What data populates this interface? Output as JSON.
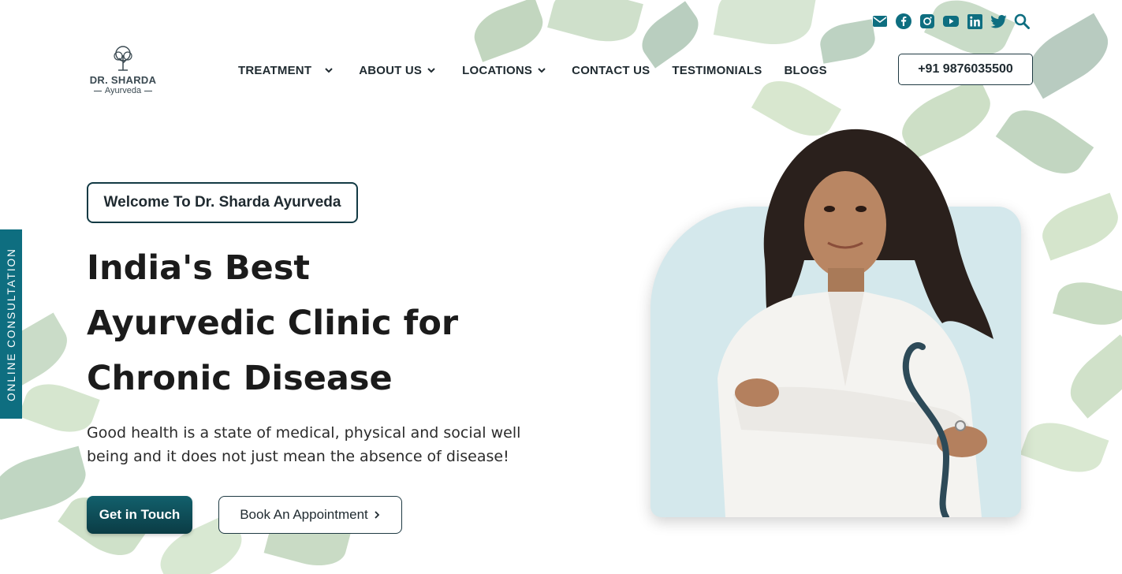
{
  "brand": {
    "name": "DR. SHARDA",
    "sub": "Ayurveda"
  },
  "nav": {
    "items": [
      {
        "label": "TREATMENT",
        "has_dropdown": true
      },
      {
        "label": "ABOUT US",
        "has_dropdown": true
      },
      {
        "label": "LOCATIONS",
        "has_dropdown": true
      },
      {
        "label": "CONTACT US",
        "has_dropdown": false
      },
      {
        "label": "TESTIMONIALS",
        "has_dropdown": false
      },
      {
        "label": "BLOGS",
        "has_dropdown": false
      }
    ],
    "phone": "+91 9876035500"
  },
  "social_icons": [
    "mail-icon",
    "facebook-icon",
    "instagram-icon",
    "youtube-icon",
    "linkedin-icon",
    "twitter-icon",
    "search-icon"
  ],
  "side_tab": {
    "label": "ONLINE CONSULTATION"
  },
  "hero": {
    "welcome": "Welcome To Dr. Sharda Ayurveda",
    "headline_lines": [
      "India's Best",
      "Ayurvedic Clinic for",
      "Chronic Disease"
    ],
    "description": "Good health is a state of medical, physical and social well being and it does not just mean the absence of disease!",
    "primary_button": "Get in Touch",
    "secondary_button": "Book An Appointment"
  },
  "colors": {
    "accent": "#0e6e80",
    "dark_teal": "#0b3c45",
    "card_bg": "#d4e8ec"
  }
}
